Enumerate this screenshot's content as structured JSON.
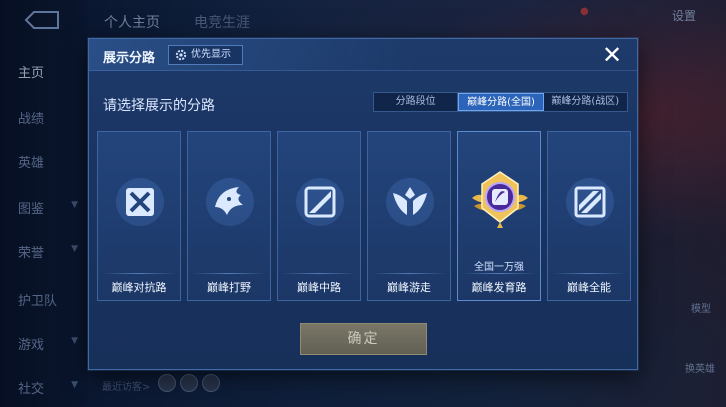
{
  "top_bar": {
    "tab_1": "个人主页",
    "tab_2": "电竞生涯",
    "settings_label": "设置"
  },
  "left_nav": {
    "items": [
      {
        "label": "主页"
      },
      {
        "label": "战绩"
      },
      {
        "label": "英雄"
      },
      {
        "label": "图鉴"
      },
      {
        "label": "荣誉"
      },
      {
        "label": "护卫队"
      },
      {
        "label": "游戏"
      },
      {
        "label": "社交"
      }
    ]
  },
  "bottom": {
    "recent_label": "最近访客>"
  },
  "side": {
    "model_label": "模型",
    "change_hero_label": "换英雄"
  },
  "modal": {
    "title": "展示分路",
    "priority_label": "优先显示",
    "close_glyph": "✕",
    "prompt": "请选择展示的分路",
    "filters": [
      {
        "label": "分路段位",
        "active": false
      },
      {
        "label": "巅峰分路(全国)",
        "active": true
      },
      {
        "label": "巅峰分路(战区)",
        "active": false
      }
    ],
    "cards": [
      {
        "label": "巅峰对抗路",
        "icon": "sword-lane-icon"
      },
      {
        "label": "巅峰打野",
        "icon": "jungle-beast-icon"
      },
      {
        "label": "巅峰中路",
        "icon": "mid-lane-icon"
      },
      {
        "label": "巅峰游走",
        "icon": "wing-shield-icon"
      },
      {
        "label": "巅峰发育路",
        "icon": "gold-badge-icon",
        "rank_text": "全国一万强"
      },
      {
        "label": "巅峰全能",
        "icon": "all-round-icon"
      }
    ],
    "confirm_label": "确定"
  },
  "colors": {
    "accent": "#2b64b8",
    "modal_bg": "#1a3462",
    "gold": "#e8b84a"
  }
}
